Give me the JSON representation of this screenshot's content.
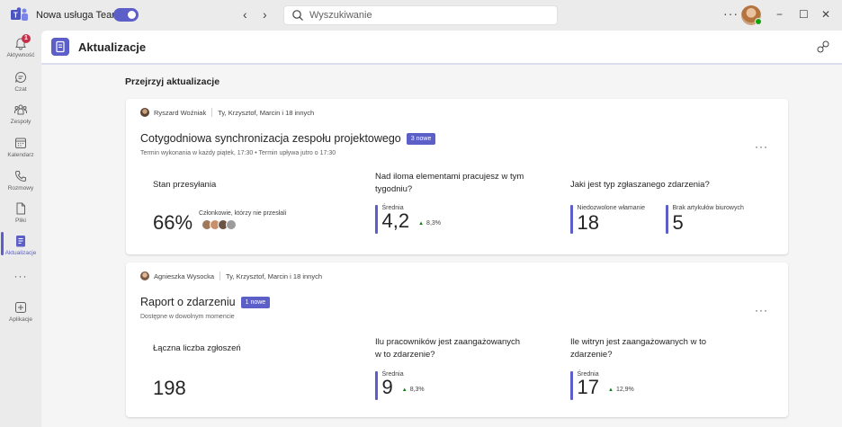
{
  "titlebar": {
    "toggle_label": "Nowa usługa Teams",
    "back": "‹",
    "forward": "›",
    "search_placeholder": "Wyszukiwanie",
    "more": "···",
    "minimize": "−",
    "maximize": "☐",
    "close": "✕"
  },
  "rail": {
    "items": [
      {
        "label": "Aktywność",
        "icon": "bell-icon",
        "badge": "1"
      },
      {
        "label": "Czat",
        "icon": "chat-icon"
      },
      {
        "label": "Zespoły",
        "icon": "teams-icon"
      },
      {
        "label": "Kalendarz",
        "icon": "calendar-icon"
      },
      {
        "label": "Rozmowy",
        "icon": "phone-icon"
      },
      {
        "label": "Pliki",
        "icon": "file-icon"
      },
      {
        "label": "Aktualizacje",
        "icon": "updates-icon"
      },
      {
        "label": "···",
        "icon": "more-icon"
      },
      {
        "label": "Aplikacje",
        "icon": "add-apps-icon"
      }
    ]
  },
  "app": {
    "title": "Aktualizacje",
    "section_title": "Przejrzyj aktualizacje"
  },
  "cards": [
    {
      "author": "Ryszard Woźniak",
      "participants": "Ty, Krzysztof, Marcin i 18 innych",
      "title": "Cotygodniowa synchronizacja zespołu projektowego",
      "new_badge": "3 nowe",
      "subtitle": "Termin wykonania w każdy piątek, 17:30  • Termin upływa jutro o 17:30",
      "more": "···",
      "col1": {
        "question": "Stan przesyłania",
        "value": "66%",
        "note": "Członkowie, którzy nie przesłali"
      },
      "col2": {
        "question": "Nad iloma elementami pracujesz w tym tygodniu?",
        "label": "Średnia",
        "value": "4,2",
        "delta": "8,3%"
      },
      "col3": {
        "question": "Jaki jest typ zgłaszanego zdarzenia?",
        "metrics": [
          {
            "label": "Niedozwolone włamanie",
            "value": "18"
          },
          {
            "label": "Brak artykułów biurowych",
            "value": "5"
          }
        ]
      }
    },
    {
      "author": "Agnieszka Wysocka",
      "participants": "Ty, Krzysztof, Marcin i 18 innych",
      "title": "Raport o zdarzeniu",
      "new_badge": "1 nowe",
      "subtitle": "Dostępne w dowolnym momencie",
      "more": "···",
      "col1": {
        "question": "Łączna liczba zgłoszeń",
        "value": "198"
      },
      "col2": {
        "question": "Ilu pracowników jest zaangażowanych w to zdarzenie?",
        "label": "Średnia",
        "value": "9",
        "delta": "8,3%"
      },
      "col3": {
        "question": "Ile witryn jest zaangażowanych w to zdarzenie?",
        "label": "Średnia",
        "value": "17",
        "delta": "12,9%"
      }
    }
  ],
  "colors": {
    "accent": "#5b5fc7",
    "positive": "#107c10",
    "alert": "#c4314b",
    "presence": "#13a10e"
  }
}
